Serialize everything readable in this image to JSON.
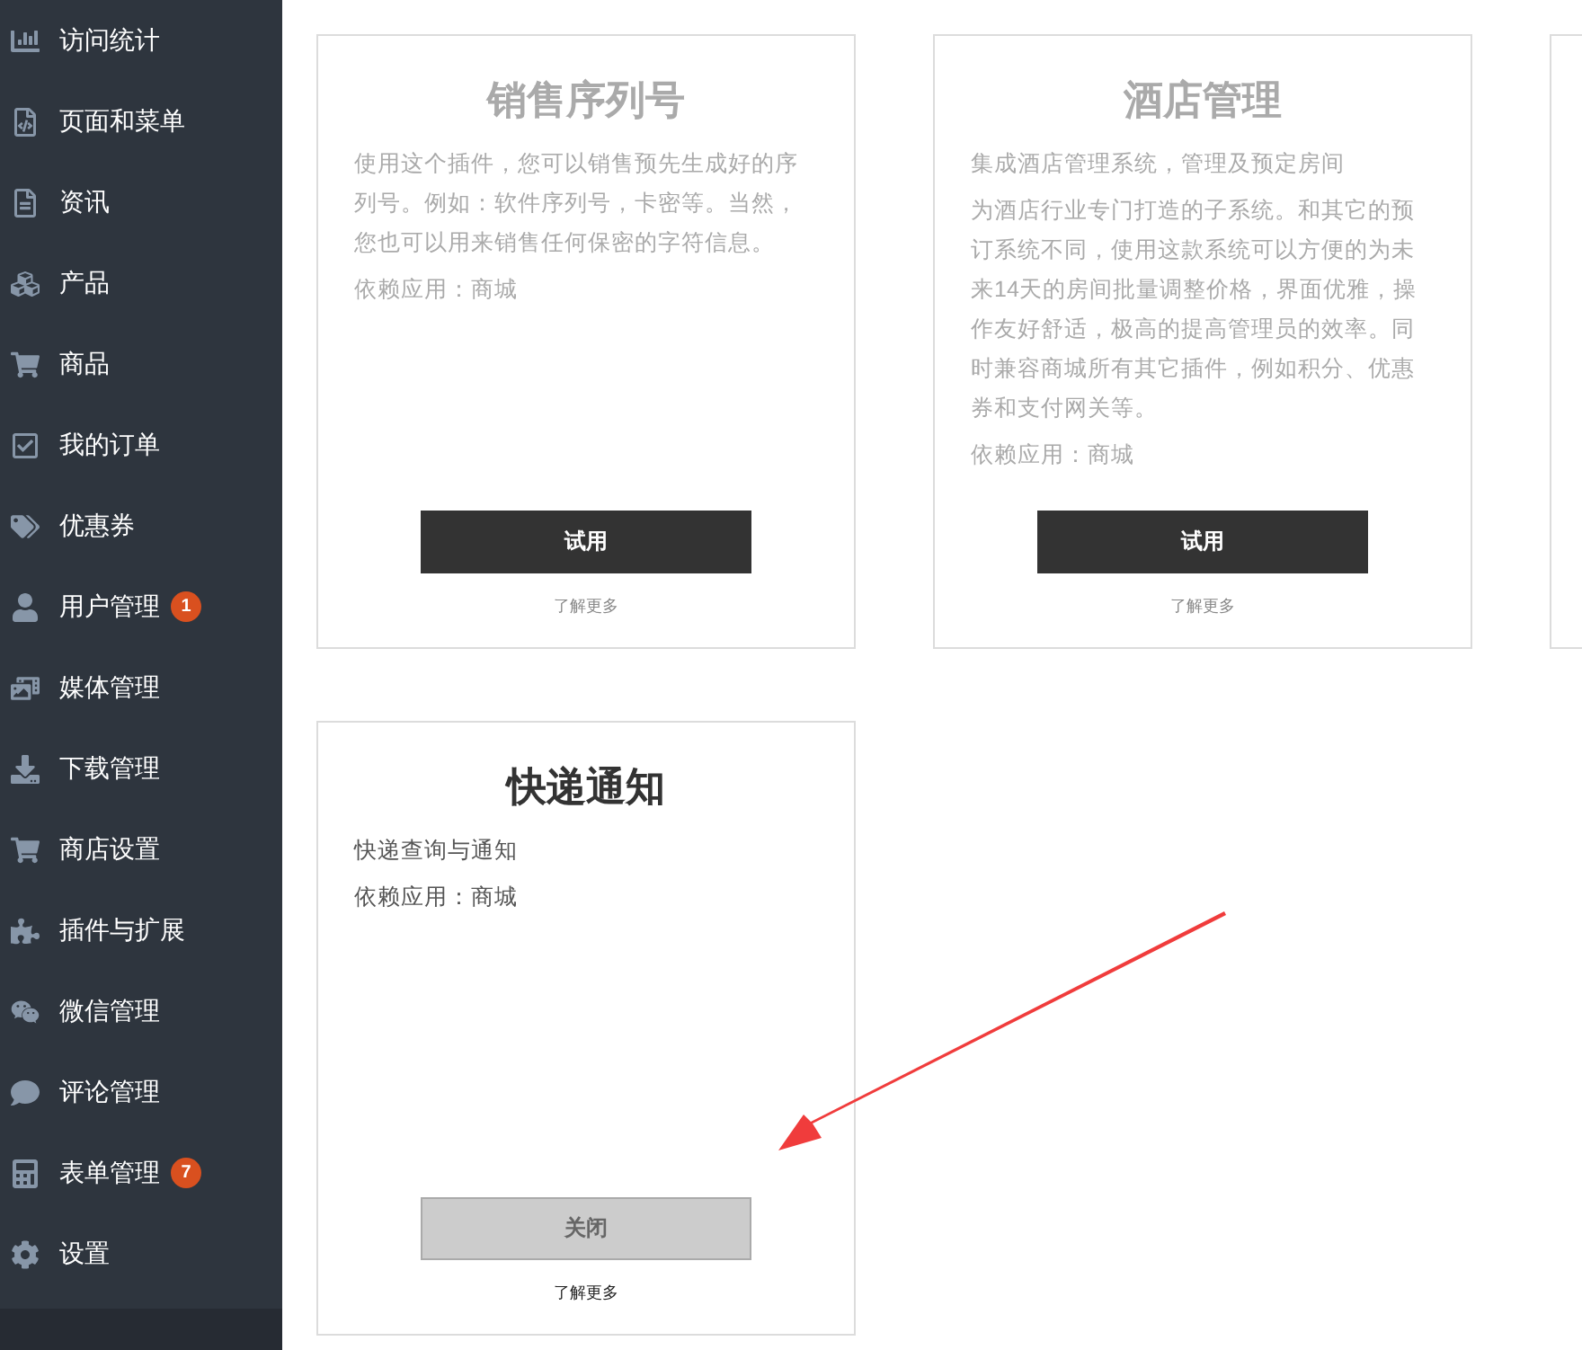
{
  "sidebar": {
    "items": [
      {
        "label": "访问统计"
      },
      {
        "label": "页面和菜单"
      },
      {
        "label": "资讯"
      },
      {
        "label": "产品"
      },
      {
        "label": "商品"
      },
      {
        "label": "我的订单"
      },
      {
        "label": "优惠券"
      },
      {
        "label": "用户管理",
        "badge": "1"
      },
      {
        "label": "媒体管理"
      },
      {
        "label": "下载管理"
      },
      {
        "label": "商店设置"
      },
      {
        "label": "插件与扩展"
      },
      {
        "label": "微信管理"
      },
      {
        "label": "评论管理"
      },
      {
        "label": "表单管理",
        "badge": "7"
      },
      {
        "label": "设置"
      }
    ]
  },
  "plugins": [
    {
      "title": "销售序列号",
      "installed": false,
      "paragraphs": [
        "使用这个插件，您可以销售预先生成好的序列号。例如：软件序列号，卡密等。当然，您也可以用来销售任何保密的字符信息。",
        "依赖应用：商城"
      ],
      "button": "试用",
      "link": "了解更多"
    },
    {
      "title": "酒店管理",
      "installed": false,
      "paragraphs": [
        "集成酒店管理系统，管理及预定房间",
        "为酒店行业专门打造的子系统。和其它的预订系统不同，使用这款系统可以方便的为未来14天的房间批量调整价格，界面优雅，操作友好舒适，极高的提高管理员的效率。同时兼容商城所有其它插件，例如积分、优惠券和支付网关等。",
        "依赖应用：商城"
      ],
      "button": "试用",
      "link": "了解更多"
    },
    {
      "title": "快递通知",
      "installed": true,
      "paragraphs": [
        "快递查询与通知",
        "依赖应用：商城"
      ],
      "button": "关闭",
      "link": "了解更多"
    }
  ]
}
